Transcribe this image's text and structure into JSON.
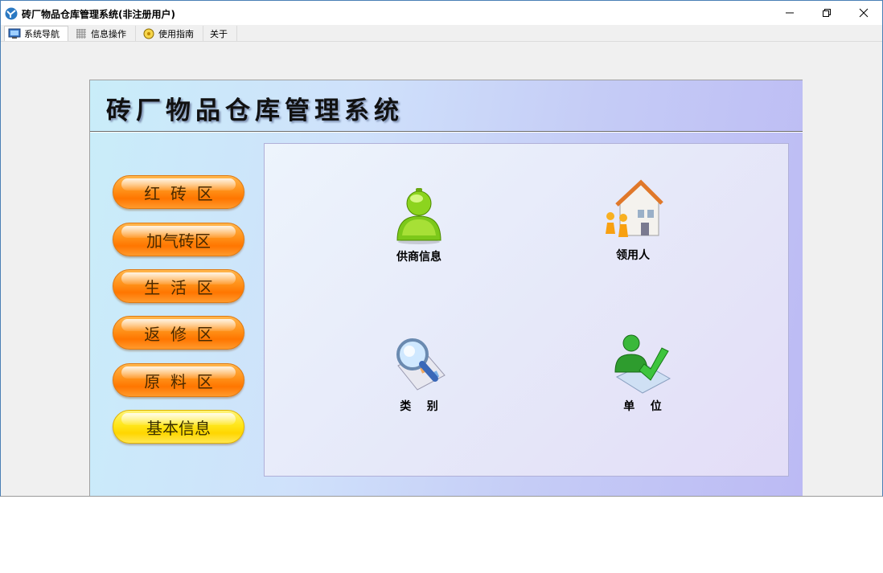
{
  "window": {
    "title": "砖厂物品仓库管理系统(非注册用户)"
  },
  "tabs": [
    {
      "label": "系统导航",
      "icon": "monitor-icon",
      "active": true
    },
    {
      "label": "信息操作",
      "icon": "grid-icon",
      "active": false
    },
    {
      "label": "使用指南",
      "icon": "compass-icon",
      "active": false
    },
    {
      "label": "关于",
      "icon": "",
      "active": false
    }
  ],
  "panel": {
    "title": "砖厂物品仓库管理系统"
  },
  "nav_buttons": [
    {
      "label": "红  砖  区",
      "color": "#ff8a10"
    },
    {
      "label": "加气砖区",
      "color": "#ff8a10"
    },
    {
      "label": "生  活  区",
      "color": "#ff8a10"
    },
    {
      "label": "返  修  区",
      "color": "#ff8a10"
    },
    {
      "label": "原  料  区",
      "color": "#ff8a10"
    },
    {
      "label": "基本信息",
      "color": "#ffe01a"
    }
  ],
  "tiles": [
    {
      "label": "供商信息",
      "icon": "supplier-person-icon"
    },
    {
      "label": "领用人",
      "icon": "recipient-house-icon"
    },
    {
      "label": "类    别",
      "icon": "category-magnifier-icon"
    },
    {
      "label": "单    位",
      "icon": "unit-person-check-icon"
    }
  ]
}
